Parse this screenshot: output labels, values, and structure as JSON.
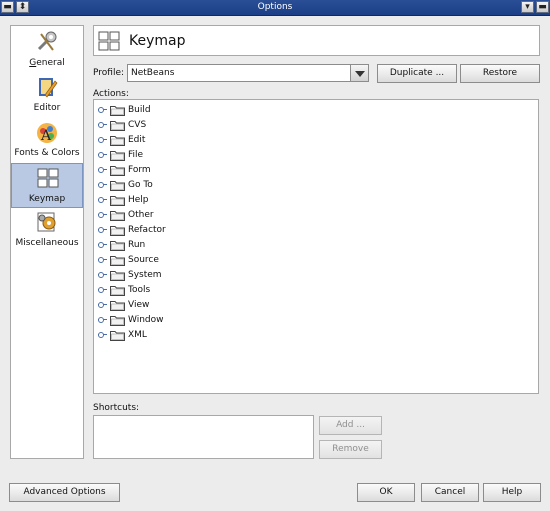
{
  "window": {
    "title": "Options",
    "left_controls": [
      "▬",
      "⬍"
    ],
    "right_controls": [
      "▾",
      "▬"
    ]
  },
  "categories": [
    {
      "id": "general",
      "label": "General",
      "icon": "wrench-icon",
      "selected": false
    },
    {
      "id": "editor",
      "label": "Editor",
      "icon": "pencil-icon",
      "selected": false
    },
    {
      "id": "fonts",
      "label": "Fonts & Colors",
      "icon": "fonts-colors-icon",
      "selected": false
    },
    {
      "id": "keymap",
      "label": "Keymap",
      "icon": "keyboard-icon",
      "selected": true
    },
    {
      "id": "misc",
      "label": "Miscellaneous",
      "icon": "gears-icon",
      "selected": false
    }
  ],
  "header": {
    "title": "Keymap",
    "icon": "keyboard-icon"
  },
  "profile": {
    "label": "Profile:",
    "value": "NetBeans",
    "duplicate_label": "Duplicate ...",
    "restore_label": "Restore"
  },
  "actions": {
    "label": "Actions:",
    "items": [
      "Build",
      "CVS",
      "Edit",
      "File",
      "Form",
      "Go To",
      "Help",
      "Other",
      "Refactor",
      "Run",
      "Source",
      "System",
      "Tools",
      "View",
      "Window",
      "XML"
    ]
  },
  "shortcuts": {
    "label": "Shortcuts:",
    "add_label": "Add ...",
    "remove_label": "Remove"
  },
  "footer": {
    "advanced_label": "Advanced Options",
    "ok_label": "OK",
    "cancel_label": "Cancel",
    "help_label": "Help"
  },
  "colors": {
    "titlebar": "#1c3f88",
    "selection": "#b9c9e3",
    "tree_connector": "#4a6da8"
  }
}
